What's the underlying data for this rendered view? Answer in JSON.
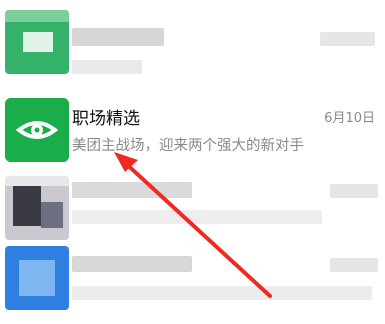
{
  "chat_list": {
    "featured_item": {
      "title": "职场精选",
      "date": "6月10日",
      "preview": "美团主战场，迎来两个强大的新对手",
      "avatar_icon": "eye-icon",
      "avatar_color": "#1aad4b"
    }
  },
  "annotation": {
    "arrow_color": "#ee2a22"
  }
}
